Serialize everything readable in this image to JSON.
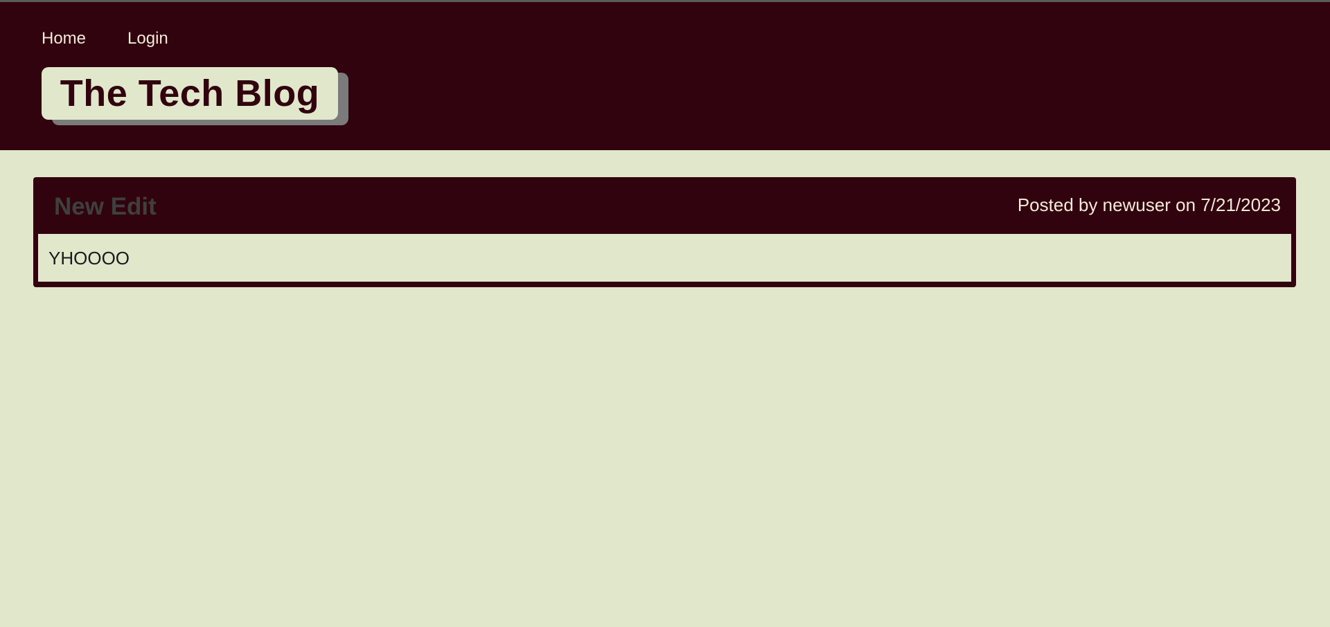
{
  "nav": {
    "items": [
      {
        "label": "Home"
      },
      {
        "label": "Login"
      }
    ]
  },
  "brand": {
    "title": "The Tech Blog"
  },
  "post": {
    "title": "New Edit",
    "meta": "Posted by newuser on 7/21/2023",
    "body": "YHOOOO"
  },
  "colors": {
    "header_bg": "#31030f",
    "page_bg": "#e1e7cb",
    "nav_text": "#f3ead8",
    "brand_text": "#31030f",
    "post_title": "#3f3f3f"
  }
}
